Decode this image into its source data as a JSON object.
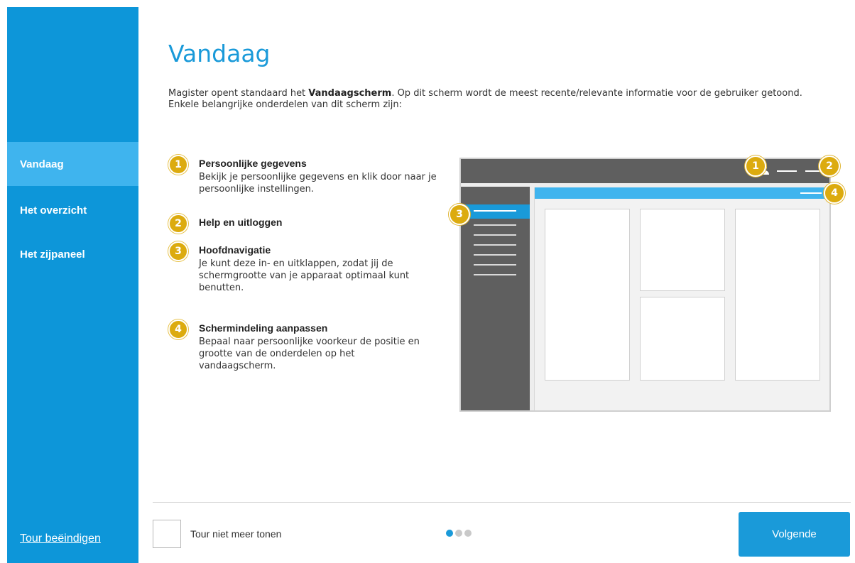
{
  "sidebar": {
    "items": [
      {
        "label": "Vandaag",
        "active": true
      },
      {
        "label": "Het overzicht",
        "active": false
      },
      {
        "label": "Het zijpaneel",
        "active": false
      }
    ],
    "end_tour": "Tour beëindigen"
  },
  "main": {
    "title": "Vandaag",
    "intro_before": "Magister opent standaard het ",
    "intro_bold": "Vandaagscherm",
    "intro_after": ". Op dit scherm wordt de meest recente/relevante informatie voor de gebruiker getoond. Enkele belangrijke onderdelen van dit scherm zijn:",
    "steps": [
      {
        "number": "1",
        "title": "Persoonlijke gegevens",
        "body": "Bekijk je persoonlijke gegevens en klik door naar je persoonlijke instellingen."
      },
      {
        "number": "2",
        "title": "Help en uitloggen",
        "body": ""
      },
      {
        "number": "3",
        "title": "Hoofdnavigatie",
        "body": "Je kunt deze in- en uitklappen, zodat jij de schermgrootte van je apparaat optimaal kunt benutten."
      },
      {
        "number": "4",
        "title": "Schermindeling aanpassen",
        "body": "Bepaal naar persoonlijke voorkeur de positie en grootte van de onderdelen op het vandaagscherm."
      }
    ],
    "mockup_badges": [
      "1",
      "2",
      "3",
      "4"
    ]
  },
  "footer": {
    "checkbox_label": "Tour niet meer tonen",
    "page_count": 3,
    "current_page": 1,
    "next_label": "Volgende"
  },
  "colors": {
    "accent": "#1a9ad9",
    "sidebar": "#0d96d9",
    "sidebar_active": "#3fb4ee",
    "badge": "#dcab0f"
  }
}
